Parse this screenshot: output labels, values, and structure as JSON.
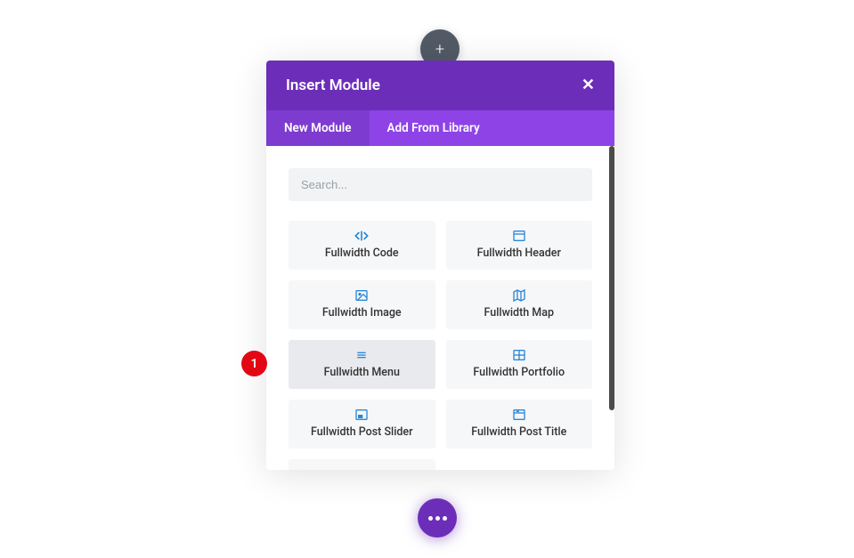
{
  "toolbar": {
    "add_button_glyph": "+"
  },
  "modal": {
    "title": "Insert Module",
    "close_glyph": "✕",
    "tabs": [
      {
        "label": "New Module",
        "active": true
      },
      {
        "label": "Add From Library",
        "active": false
      }
    ],
    "search_placeholder": "Search..."
  },
  "modules": [
    {
      "label": "Fullwidth Code",
      "icon": "code-icon"
    },
    {
      "label": "Fullwidth Header",
      "icon": "header-icon"
    },
    {
      "label": "Fullwidth Image",
      "icon": "image-icon"
    },
    {
      "label": "Fullwidth Map",
      "icon": "map-icon"
    },
    {
      "label": "Fullwidth Menu",
      "icon": "menu-icon",
      "highlighted": true
    },
    {
      "label": "Fullwidth Portfolio",
      "icon": "portfolio-icon"
    },
    {
      "label": "Fullwidth Post Slider",
      "icon": "post-slider-icon"
    },
    {
      "label": "Fullwidth Post Title",
      "icon": "post-title-icon"
    }
  ],
  "annotation": {
    "number": "1"
  }
}
